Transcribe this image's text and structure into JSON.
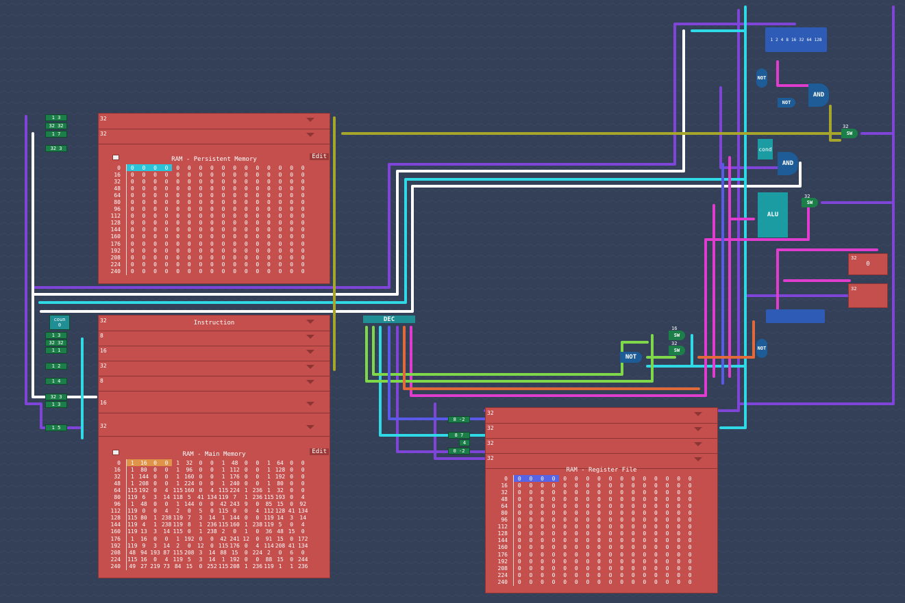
{
  "ram_persistent": {
    "title": "RAM - Persistent Memory",
    "edit_label": "Edit",
    "port_labels": [
      "32",
      "32"
    ],
    "addresses": [
      "0",
      "16",
      "32",
      "48",
      "64",
      "80",
      "96",
      "112",
      "128",
      "144",
      "160",
      "176",
      "192",
      "208",
      "224",
      "240"
    ],
    "rows": [
      [
        "0",
        "0",
        "0",
        "0",
        "0",
        "0",
        "0",
        "0",
        "0",
        "0",
        "0",
        "0",
        "0",
        "0",
        "0",
        "0"
      ],
      [
        "0",
        "0",
        "0",
        "0",
        "0",
        "0",
        "0",
        "0",
        "0",
        "0",
        "0",
        "0",
        "0",
        "0",
        "0",
        "0"
      ],
      [
        "0",
        "0",
        "0",
        "0",
        "0",
        "0",
        "0",
        "0",
        "0",
        "0",
        "0",
        "0",
        "0",
        "0",
        "0",
        "0"
      ],
      [
        "0",
        "0",
        "0",
        "0",
        "0",
        "0",
        "0",
        "0",
        "0",
        "0",
        "0",
        "0",
        "0",
        "0",
        "0",
        "0"
      ],
      [
        "0",
        "0",
        "0",
        "0",
        "0",
        "0",
        "0",
        "0",
        "0",
        "0",
        "0",
        "0",
        "0",
        "0",
        "0",
        "0"
      ],
      [
        "0",
        "0",
        "0",
        "0",
        "0",
        "0",
        "0",
        "0",
        "0",
        "0",
        "0",
        "0",
        "0",
        "0",
        "0",
        "0"
      ],
      [
        "0",
        "0",
        "0",
        "0",
        "0",
        "0",
        "0",
        "0",
        "0",
        "0",
        "0",
        "0",
        "0",
        "0",
        "0",
        "0"
      ],
      [
        "0",
        "0",
        "0",
        "0",
        "0",
        "0",
        "0",
        "0",
        "0",
        "0",
        "0",
        "0",
        "0",
        "0",
        "0",
        "0"
      ],
      [
        "0",
        "0",
        "0",
        "0",
        "0",
        "0",
        "0",
        "0",
        "0",
        "0",
        "0",
        "0",
        "0",
        "0",
        "0",
        "0"
      ],
      [
        "0",
        "0",
        "0",
        "0",
        "0",
        "0",
        "0",
        "0",
        "0",
        "0",
        "0",
        "0",
        "0",
        "0",
        "0",
        "0"
      ],
      [
        "0",
        "0",
        "0",
        "0",
        "0",
        "0",
        "0",
        "0",
        "0",
        "0",
        "0",
        "0",
        "0",
        "0",
        "0",
        "0"
      ],
      [
        "0",
        "0",
        "0",
        "0",
        "0",
        "0",
        "0",
        "0",
        "0",
        "0",
        "0",
        "0",
        "0",
        "0",
        "0",
        "0"
      ],
      [
        "0",
        "0",
        "0",
        "0",
        "0",
        "0",
        "0",
        "0",
        "0",
        "0",
        "0",
        "0",
        "0",
        "0",
        "0",
        "0"
      ],
      [
        "0",
        "0",
        "0",
        "0",
        "0",
        "0",
        "0",
        "0",
        "0",
        "0",
        "0",
        "0",
        "0",
        "0",
        "0",
        "0"
      ],
      [
        "0",
        "0",
        "0",
        "0",
        "0",
        "0",
        "0",
        "0",
        "0",
        "0",
        "0",
        "0",
        "0",
        "0",
        "0",
        "0"
      ],
      [
        "0",
        "0",
        "0",
        "0",
        "0",
        "0",
        "0",
        "0",
        "0",
        "0",
        "0",
        "0",
        "0",
        "0",
        "0",
        "0"
      ]
    ]
  },
  "ram_main": {
    "title": "RAM - Main Memory",
    "instruction_label": "Instruction",
    "edit_label": "Edit",
    "port_labels": [
      "32",
      "8",
      "16",
      "32",
      "8",
      "16",
      "32"
    ],
    "addresses": [
      "0",
      "16",
      "32",
      "48",
      "64",
      "80",
      "96",
      "112",
      "128",
      "144",
      "160",
      "176",
      "192",
      "208",
      "224",
      "240"
    ],
    "rows": [
      [
        "1",
        "16",
        "0",
        "0",
        "1",
        "32",
        "0",
        "0",
        "1",
        "48",
        "0",
        "0",
        "1",
        "64",
        "0",
        "0"
      ],
      [
        "1",
        "80",
        "0",
        "0",
        "1",
        "96",
        "0",
        "0",
        "1",
        "112",
        "0",
        "0",
        "1",
        "128",
        "0",
        "0"
      ],
      [
        "1",
        "144",
        "0",
        "0",
        "1",
        "160",
        "0",
        "0",
        "1",
        "176",
        "0",
        "0",
        "1",
        "192",
        "0",
        "0"
      ],
      [
        "1",
        "208",
        "0",
        "0",
        "1",
        "224",
        "0",
        "0",
        "1",
        "240",
        "0",
        "0",
        "1",
        "80",
        "0",
        "0"
      ],
      [
        "115",
        "192",
        "0",
        "4",
        "115",
        "160",
        "0",
        "4",
        "115",
        "224",
        "1",
        "236",
        "1",
        "32",
        "0",
        "0"
      ],
      [
        "119",
        "6",
        "3",
        "14",
        "118",
        "5",
        "41",
        "134",
        "119",
        "7",
        "1",
        "236",
        "115",
        "193",
        "0",
        "4"
      ],
      [
        "1",
        "48",
        "0",
        "0",
        "1",
        "144",
        "0",
        "0",
        "42",
        "243",
        "9",
        "0",
        "85",
        "15",
        "0",
        "92"
      ],
      [
        "119",
        "0",
        "0",
        "4",
        "2",
        "0",
        "5",
        "0",
        "115",
        "0",
        "0",
        "4",
        "112",
        "128",
        "41",
        "134"
      ],
      [
        "115",
        "80",
        "1",
        "238",
        "119",
        "7",
        "3",
        "14",
        "1",
        "144",
        "0",
        "0",
        "119",
        "14",
        "3",
        "14"
      ],
      [
        "119",
        "4",
        "1",
        "238",
        "119",
        "8",
        "1",
        "236",
        "115",
        "160",
        "1",
        "238",
        "119",
        "5",
        "0",
        "4"
      ],
      [
        "119",
        "13",
        "3",
        "14",
        "115",
        "0",
        "1",
        "238",
        "2",
        "0",
        "1",
        "0",
        "36",
        "48",
        "15",
        "0"
      ],
      [
        "1",
        "16",
        "0",
        "0",
        "1",
        "192",
        "0",
        "0",
        "42",
        "241",
        "12",
        "0",
        "91",
        "15",
        "0",
        "172"
      ],
      [
        "119",
        "9",
        "3",
        "14",
        "2",
        "0",
        "12",
        "0",
        "115",
        "176",
        "0",
        "4",
        "114",
        "208",
        "41",
        "134"
      ],
      [
        "48",
        "94",
        "193",
        "87",
        "115",
        "208",
        "3",
        "14",
        "88",
        "15",
        "0",
        "224",
        "2",
        "0",
        "6",
        "0"
      ],
      [
        "115",
        "16",
        "0",
        "4",
        "119",
        "5",
        "3",
        "14",
        "1",
        "192",
        "0",
        "0",
        "88",
        "15",
        "0",
        "244"
      ],
      [
        "49",
        "27",
        "219",
        "73",
        "84",
        "15",
        "0",
        "252",
        "115",
        "208",
        "1",
        "236",
        "119",
        "1",
        "1",
        "236"
      ]
    ]
  },
  "ram_register": {
    "title": "RAM - Register File",
    "port_labels": [
      "32",
      "32",
      "32",
      "32"
    ],
    "addresses": [
      "0",
      "16",
      "32",
      "48",
      "64",
      "80",
      "96",
      "112",
      "128",
      "144",
      "160",
      "176",
      "192",
      "208",
      "224",
      "240"
    ],
    "rows": [
      [
        "0",
        "0",
        "0",
        "0",
        "0",
        "0",
        "0",
        "0",
        "0",
        "0",
        "0",
        "0",
        "0",
        "0",
        "0",
        "0"
      ],
      [
        "0",
        "0",
        "0",
        "0",
        "0",
        "0",
        "0",
        "0",
        "0",
        "0",
        "0",
        "0",
        "0",
        "0",
        "0",
        "0"
      ],
      [
        "0",
        "0",
        "0",
        "0",
        "0",
        "0",
        "0",
        "0",
        "0",
        "0",
        "0",
        "0",
        "0",
        "0",
        "0",
        "0"
      ],
      [
        "0",
        "0",
        "0",
        "0",
        "0",
        "0",
        "0",
        "0",
        "0",
        "0",
        "0",
        "0",
        "0",
        "0",
        "0",
        "0"
      ],
      [
        "0",
        "0",
        "0",
        "0",
        "0",
        "0",
        "0",
        "0",
        "0",
        "0",
        "0",
        "0",
        "0",
        "0",
        "0",
        "0"
      ],
      [
        "0",
        "0",
        "0",
        "0",
        "0",
        "0",
        "0",
        "0",
        "0",
        "0",
        "0",
        "0",
        "0",
        "0",
        "0",
        "0"
      ],
      [
        "0",
        "0",
        "0",
        "0",
        "0",
        "0",
        "0",
        "0",
        "0",
        "0",
        "0",
        "0",
        "0",
        "0",
        "0",
        "0"
      ],
      [
        "0",
        "0",
        "0",
        "0",
        "0",
        "0",
        "0",
        "0",
        "0",
        "0",
        "0",
        "0",
        "0",
        "0",
        "0",
        "0"
      ],
      [
        "0",
        "0",
        "0",
        "0",
        "0",
        "0",
        "0",
        "0",
        "0",
        "0",
        "0",
        "0",
        "0",
        "0",
        "0",
        "0"
      ],
      [
        "0",
        "0",
        "0",
        "0",
        "0",
        "0",
        "0",
        "0",
        "0",
        "0",
        "0",
        "0",
        "0",
        "0",
        "0",
        "0"
      ],
      [
        "0",
        "0",
        "0",
        "0",
        "0",
        "0",
        "0",
        "0",
        "0",
        "0",
        "0",
        "0",
        "0",
        "0",
        "0",
        "0"
      ],
      [
        "0",
        "0",
        "0",
        "0",
        "0",
        "0",
        "0",
        "0",
        "0",
        "0",
        "0",
        "0",
        "0",
        "0",
        "0",
        "0"
      ],
      [
        "0",
        "0",
        "0",
        "0",
        "0",
        "0",
        "0",
        "0",
        "0",
        "0",
        "0",
        "0",
        "0",
        "0",
        "0",
        "0"
      ],
      [
        "0",
        "0",
        "0",
        "0",
        "0",
        "0",
        "0",
        "0",
        "0",
        "0",
        "0",
        "0",
        "0",
        "0",
        "0",
        "0"
      ],
      [
        "0",
        "0",
        "0",
        "0",
        "0",
        "0",
        "0",
        "0",
        "0",
        "0",
        "0",
        "0",
        "0",
        "0",
        "0",
        "0"
      ],
      [
        "0",
        "0",
        "0",
        "0",
        "0",
        "0",
        "0",
        "0",
        "0",
        "0",
        "0",
        "0",
        "0",
        "0",
        "0",
        "0"
      ]
    ]
  },
  "components": {
    "dec_label": "DEC",
    "alu_label": "ALU",
    "cond_label": "cond",
    "and_label": "AND",
    "not_label": "NOT",
    "switch_label": "SW",
    "counter_label": "coun",
    "counter_value": "0",
    "output_value": "0",
    "bit_labels": [
      "1",
      "2",
      "4",
      "8",
      "16",
      "32",
      "64",
      "128"
    ],
    "width_labels": [
      "32",
      "32",
      "16",
      "32",
      "32",
      "32",
      "32",
      "32"
    ],
    "left_inputs": [
      "1  3",
      "32  32",
      "1  7",
      "32  3",
      "1  3",
      "32  32",
      "1  1",
      "1  2",
      "1  4",
      "32  3",
      "1  3",
      "1  5"
    ],
    "mid_inputs": [
      "8  -2",
      "8  7",
      "4",
      "0  -2"
    ]
  },
  "colors": {
    "background": "#343f58",
    "ram": "#c54f4d",
    "purple": "#7f45d8",
    "white": "#ffffff",
    "cyan": "#2fd9e6",
    "olive": "#a6a62c",
    "pink": "#e03ccd",
    "lime": "#7fd84a",
    "orange": "#e26a3a",
    "blue": "#5a5ae8"
  }
}
